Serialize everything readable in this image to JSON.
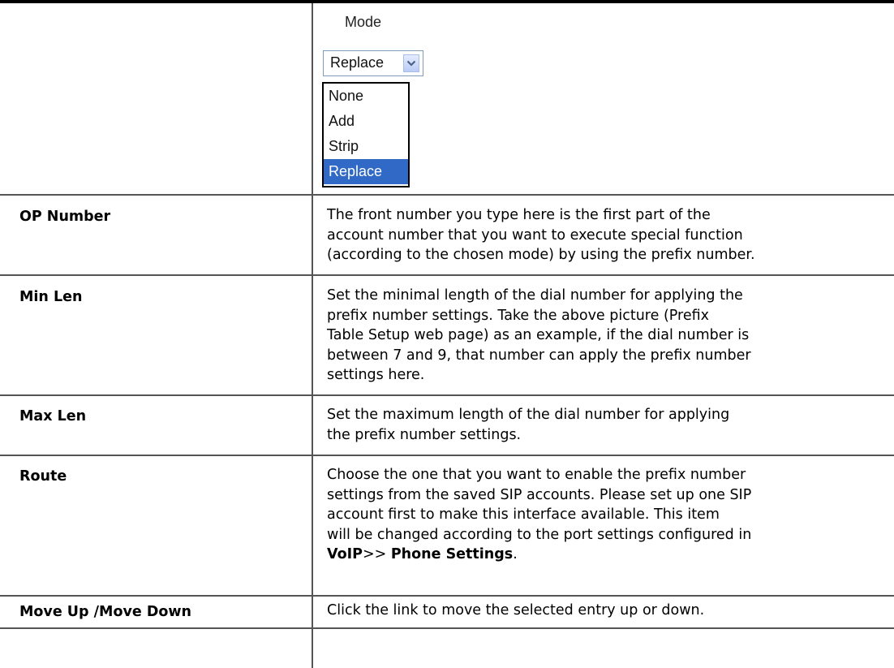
{
  "mode_widget": {
    "label": "Mode",
    "selected_value": "Replace",
    "arrow_icon": "chevron-down-icon",
    "options": [
      "None",
      "Add",
      "Strip",
      "Replace"
    ],
    "highlighted_option": "Replace",
    "highlight_color": "#3169c6"
  },
  "rows": [
    {
      "term": "OP Number",
      "lines": [
        "The front number you type here is the first part of the",
        "account number that you want to execute special function",
        "(according to the chosen mode) by using the prefix number."
      ]
    },
    {
      "term": "Min Len",
      "lines": [
        "Set the minimal length of the dial number for applying the",
        "prefix number settings. Take the above picture (Prefix",
        "Table Setup web page) as an example, if the dial number is",
        "between 7 and 9, that number can apply the prefix number",
        "settings here."
      ]
    },
    {
      "term": "Max Len",
      "lines": [
        "Set the maximum length of the dial number for applying",
        "the prefix number settings."
      ]
    },
    {
      "term": "Route",
      "lines": [
        "Choose the one that you want to enable the prefix number",
        "settings from the saved SIP accounts. Please set up one SIP",
        "account first to make this interface available. This item",
        "will be changed according to the port settings configured in"
      ],
      "last_line_bold_1": "VoIP",
      "last_line_text": ">> ",
      "last_line_bold_2": "Phone Settings",
      "last_line_end": "."
    },
    {
      "term": "Move Up /Move Down",
      "lines": [
        "Click the link to move the selected entry up or down."
      ]
    }
  ]
}
